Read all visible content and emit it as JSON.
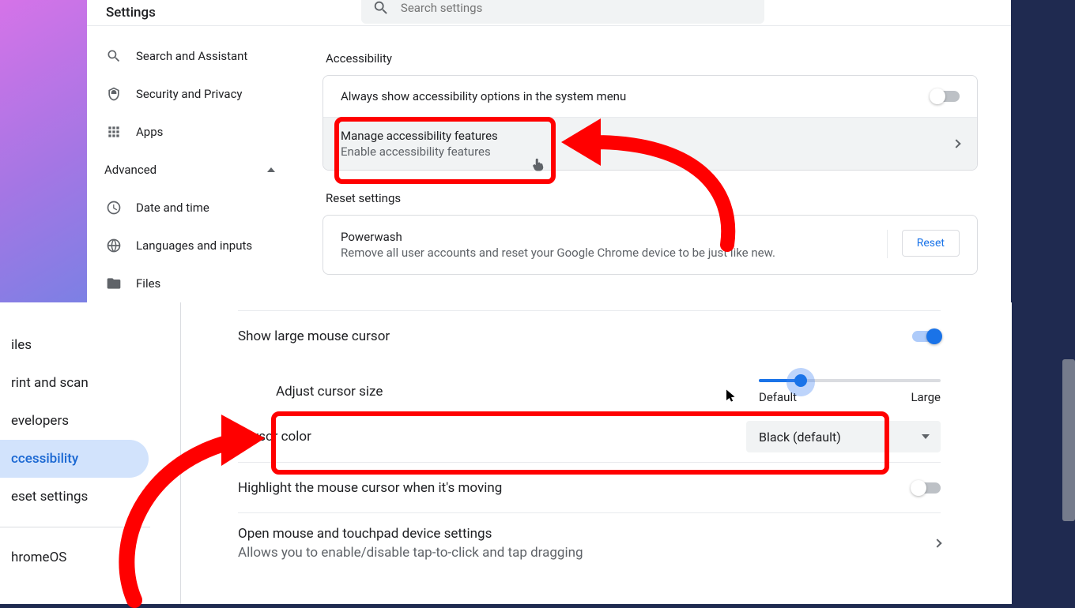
{
  "top": {
    "title": "Settings",
    "search_placeholder": "Search settings",
    "nav": {
      "search_assistant": "Search and Assistant",
      "security_privacy": "Security and Privacy",
      "apps": "Apps",
      "advanced": "Advanced",
      "date_time": "Date and time",
      "languages": "Languages and inputs",
      "files": "Files"
    },
    "section_accessibility": "Accessibility",
    "always_show": "Always show accessibility options in the system menu",
    "manage_title": "Manage accessibility features",
    "manage_sub": "Enable accessibility features",
    "section_reset": "Reset settings",
    "powerwash_title": "Powerwash",
    "powerwash_sub": "Remove all user accounts and reset your Google Chrome device to be just like new.",
    "reset_btn": "Reset"
  },
  "bottom": {
    "nav": {
      "files": "iles",
      "print": "rint and scan",
      "dev": "evelopers",
      "accessibility": "ccessibility",
      "reset": "eset settings",
      "chromeos": "hromeOS"
    },
    "show_large": "Show large mouse cursor",
    "adjust_label": "Adjust cursor size",
    "slider_min": "Default",
    "slider_max": "Large",
    "slider_value_pct": 23,
    "cursor_color_label": "Cursor color",
    "cursor_color_value": "Black (default)",
    "highlight_label": "Highlight the mouse cursor when it's moving",
    "open_touchpad_title": "Open mouse and touchpad device settings",
    "open_touchpad_sub": "Allows you to enable/disable tap-to-click and tap dragging"
  }
}
